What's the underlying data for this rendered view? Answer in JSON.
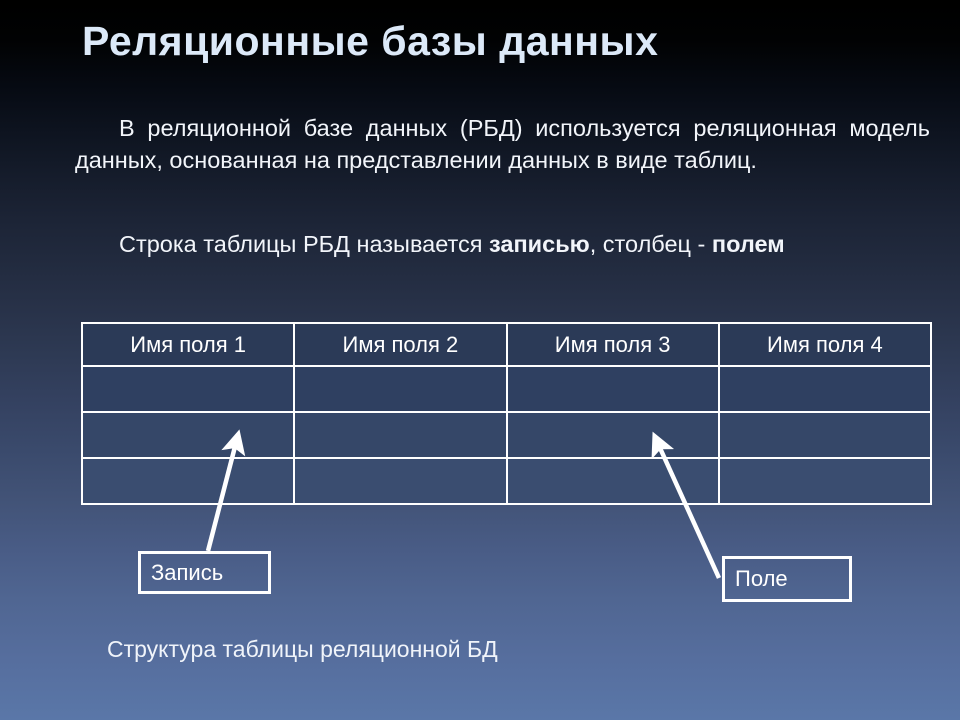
{
  "slide": {
    "title": "Реляционные базы данных",
    "background": {
      "top_color": "#000000",
      "bottom_color": "#5a77a8"
    },
    "title_color": "#dce9f8",
    "text_color": "#f2f5fa",
    "line_color": "#ffffff"
  },
  "paragraphs": {
    "p1_part1": "В реляционной базе данных (РБД) используется реляционная модель данных, основанная на представлении данных в виде таблиц.",
    "p2_part1": "Строка таблицы РБД называется ",
    "p2_bold1": "записью",
    "p2_part2": ", столбец - ",
    "p2_bold2": "полем"
  },
  "table": {
    "headers": [
      "Имя поля 1",
      "Имя поля 2",
      "Имя поля 3",
      "Имя поля 4"
    ],
    "rows": [
      [
        "",
        "",
        "",
        ""
      ],
      [
        "",
        "",
        "",
        ""
      ],
      [
        "",
        "",
        "",
        ""
      ]
    ]
  },
  "callouts": {
    "record": "Запись",
    "field": "Поле"
  },
  "caption": "Структура таблицы реляционной БД"
}
